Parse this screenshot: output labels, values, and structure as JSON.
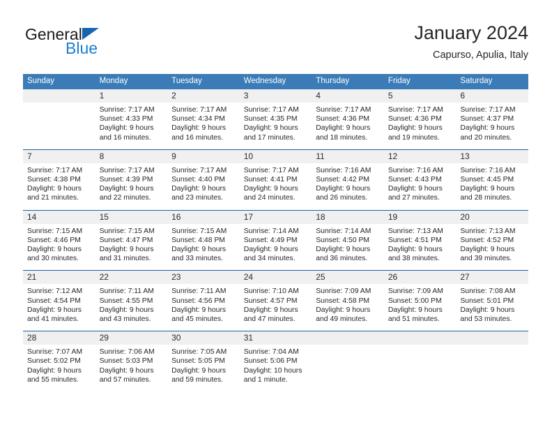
{
  "branding": {
    "name_top": "General",
    "name_bottom": "Blue",
    "accent_blue": "#1565b0",
    "text_blue": "#1a7dd2"
  },
  "header": {
    "title": "January 2024",
    "subtitle": "Capurso, Apulia, Italy"
  },
  "theme": {
    "header_bg": "#3b7cb8",
    "daynum_bg": "#f0f0f0",
    "rule_color": "#1d5fa0"
  },
  "weekday_headers": [
    "Sunday",
    "Monday",
    "Tuesday",
    "Wednesday",
    "Thursday",
    "Friday",
    "Saturday"
  ],
  "weeks": [
    {
      "days": [
        {
          "date": "",
          "sunrise": "",
          "sunset": "",
          "daylight_line1": "",
          "daylight_line2": ""
        },
        {
          "date": "1",
          "sunrise": "Sunrise: 7:17 AM",
          "sunset": "Sunset: 4:33 PM",
          "daylight_line1": "Daylight: 9 hours",
          "daylight_line2": "and 16 minutes."
        },
        {
          "date": "2",
          "sunrise": "Sunrise: 7:17 AM",
          "sunset": "Sunset: 4:34 PM",
          "daylight_line1": "Daylight: 9 hours",
          "daylight_line2": "and 16 minutes."
        },
        {
          "date": "3",
          "sunrise": "Sunrise: 7:17 AM",
          "sunset": "Sunset: 4:35 PM",
          "daylight_line1": "Daylight: 9 hours",
          "daylight_line2": "and 17 minutes."
        },
        {
          "date": "4",
          "sunrise": "Sunrise: 7:17 AM",
          "sunset": "Sunset: 4:36 PM",
          "daylight_line1": "Daylight: 9 hours",
          "daylight_line2": "and 18 minutes."
        },
        {
          "date": "5",
          "sunrise": "Sunrise: 7:17 AM",
          "sunset": "Sunset: 4:36 PM",
          "daylight_line1": "Daylight: 9 hours",
          "daylight_line2": "and 19 minutes."
        },
        {
          "date": "6",
          "sunrise": "Sunrise: 7:17 AM",
          "sunset": "Sunset: 4:37 PM",
          "daylight_line1": "Daylight: 9 hours",
          "daylight_line2": "and 20 minutes."
        }
      ]
    },
    {
      "days": [
        {
          "date": "7",
          "sunrise": "Sunrise: 7:17 AM",
          "sunset": "Sunset: 4:38 PM",
          "daylight_line1": "Daylight: 9 hours",
          "daylight_line2": "and 21 minutes."
        },
        {
          "date": "8",
          "sunrise": "Sunrise: 7:17 AM",
          "sunset": "Sunset: 4:39 PM",
          "daylight_line1": "Daylight: 9 hours",
          "daylight_line2": "and 22 minutes."
        },
        {
          "date": "9",
          "sunrise": "Sunrise: 7:17 AM",
          "sunset": "Sunset: 4:40 PM",
          "daylight_line1": "Daylight: 9 hours",
          "daylight_line2": "and 23 minutes."
        },
        {
          "date": "10",
          "sunrise": "Sunrise: 7:17 AM",
          "sunset": "Sunset: 4:41 PM",
          "daylight_line1": "Daylight: 9 hours",
          "daylight_line2": "and 24 minutes."
        },
        {
          "date": "11",
          "sunrise": "Sunrise: 7:16 AM",
          "sunset": "Sunset: 4:42 PM",
          "daylight_line1": "Daylight: 9 hours",
          "daylight_line2": "and 26 minutes."
        },
        {
          "date": "12",
          "sunrise": "Sunrise: 7:16 AM",
          "sunset": "Sunset: 4:43 PM",
          "daylight_line1": "Daylight: 9 hours",
          "daylight_line2": "and 27 minutes."
        },
        {
          "date": "13",
          "sunrise": "Sunrise: 7:16 AM",
          "sunset": "Sunset: 4:45 PM",
          "daylight_line1": "Daylight: 9 hours",
          "daylight_line2": "and 28 minutes."
        }
      ]
    },
    {
      "days": [
        {
          "date": "14",
          "sunrise": "Sunrise: 7:15 AM",
          "sunset": "Sunset: 4:46 PM",
          "daylight_line1": "Daylight: 9 hours",
          "daylight_line2": "and 30 minutes."
        },
        {
          "date": "15",
          "sunrise": "Sunrise: 7:15 AM",
          "sunset": "Sunset: 4:47 PM",
          "daylight_line1": "Daylight: 9 hours",
          "daylight_line2": "and 31 minutes."
        },
        {
          "date": "16",
          "sunrise": "Sunrise: 7:15 AM",
          "sunset": "Sunset: 4:48 PM",
          "daylight_line1": "Daylight: 9 hours",
          "daylight_line2": "and 33 minutes."
        },
        {
          "date": "17",
          "sunrise": "Sunrise: 7:14 AM",
          "sunset": "Sunset: 4:49 PM",
          "daylight_line1": "Daylight: 9 hours",
          "daylight_line2": "and 34 minutes."
        },
        {
          "date": "18",
          "sunrise": "Sunrise: 7:14 AM",
          "sunset": "Sunset: 4:50 PM",
          "daylight_line1": "Daylight: 9 hours",
          "daylight_line2": "and 36 minutes."
        },
        {
          "date": "19",
          "sunrise": "Sunrise: 7:13 AM",
          "sunset": "Sunset: 4:51 PM",
          "daylight_line1": "Daylight: 9 hours",
          "daylight_line2": "and 38 minutes."
        },
        {
          "date": "20",
          "sunrise": "Sunrise: 7:13 AM",
          "sunset": "Sunset: 4:52 PM",
          "daylight_line1": "Daylight: 9 hours",
          "daylight_line2": "and 39 minutes."
        }
      ]
    },
    {
      "days": [
        {
          "date": "21",
          "sunrise": "Sunrise: 7:12 AM",
          "sunset": "Sunset: 4:54 PM",
          "daylight_line1": "Daylight: 9 hours",
          "daylight_line2": "and 41 minutes."
        },
        {
          "date": "22",
          "sunrise": "Sunrise: 7:11 AM",
          "sunset": "Sunset: 4:55 PM",
          "daylight_line1": "Daylight: 9 hours",
          "daylight_line2": "and 43 minutes."
        },
        {
          "date": "23",
          "sunrise": "Sunrise: 7:11 AM",
          "sunset": "Sunset: 4:56 PM",
          "daylight_line1": "Daylight: 9 hours",
          "daylight_line2": "and 45 minutes."
        },
        {
          "date": "24",
          "sunrise": "Sunrise: 7:10 AM",
          "sunset": "Sunset: 4:57 PM",
          "daylight_line1": "Daylight: 9 hours",
          "daylight_line2": "and 47 minutes."
        },
        {
          "date": "25",
          "sunrise": "Sunrise: 7:09 AM",
          "sunset": "Sunset: 4:58 PM",
          "daylight_line1": "Daylight: 9 hours",
          "daylight_line2": "and 49 minutes."
        },
        {
          "date": "26",
          "sunrise": "Sunrise: 7:09 AM",
          "sunset": "Sunset: 5:00 PM",
          "daylight_line1": "Daylight: 9 hours",
          "daylight_line2": "and 51 minutes."
        },
        {
          "date": "27",
          "sunrise": "Sunrise: 7:08 AM",
          "sunset": "Sunset: 5:01 PM",
          "daylight_line1": "Daylight: 9 hours",
          "daylight_line2": "and 53 minutes."
        }
      ]
    },
    {
      "days": [
        {
          "date": "28",
          "sunrise": "Sunrise: 7:07 AM",
          "sunset": "Sunset: 5:02 PM",
          "daylight_line1": "Daylight: 9 hours",
          "daylight_line2": "and 55 minutes."
        },
        {
          "date": "29",
          "sunrise": "Sunrise: 7:06 AM",
          "sunset": "Sunset: 5:03 PM",
          "daylight_line1": "Daylight: 9 hours",
          "daylight_line2": "and 57 minutes."
        },
        {
          "date": "30",
          "sunrise": "Sunrise: 7:05 AM",
          "sunset": "Sunset: 5:05 PM",
          "daylight_line1": "Daylight: 9 hours",
          "daylight_line2": "and 59 minutes."
        },
        {
          "date": "31",
          "sunrise": "Sunrise: 7:04 AM",
          "sunset": "Sunset: 5:06 PM",
          "daylight_line1": "Daylight: 10 hours",
          "daylight_line2": "and 1 minute."
        },
        {
          "date": "",
          "sunrise": "",
          "sunset": "",
          "daylight_line1": "",
          "daylight_line2": ""
        },
        {
          "date": "",
          "sunrise": "",
          "sunset": "",
          "daylight_line1": "",
          "daylight_line2": ""
        },
        {
          "date": "",
          "sunrise": "",
          "sunset": "",
          "daylight_line1": "",
          "daylight_line2": ""
        }
      ]
    }
  ]
}
